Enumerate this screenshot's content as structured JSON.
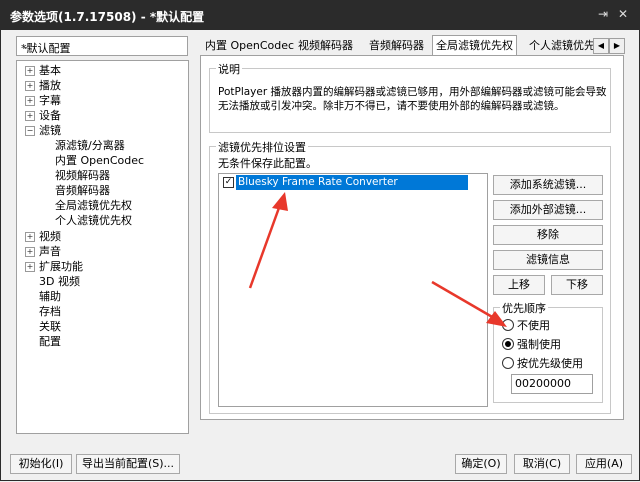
{
  "window": {
    "title": "参数选项(1.7.17508) - *默认配置",
    "pin_glyph": "⇥",
    "close_glyph": "✕"
  },
  "preset": {
    "value": "*默认配置"
  },
  "tree": [
    {
      "label": "基本",
      "expander": "+"
    },
    {
      "label": "播放",
      "expander": "+"
    },
    {
      "label": "字幕",
      "expander": "+"
    },
    {
      "label": "设备",
      "expander": "+"
    },
    {
      "label": "滤镜",
      "expander": "−"
    },
    {
      "label": "源滤镜/分离器"
    },
    {
      "label": "内置 OpenCodec"
    },
    {
      "label": "视频解码器"
    },
    {
      "label": "音频解码器"
    },
    {
      "label": "全局滤镜优先权"
    },
    {
      "label": "个人滤镜优先权"
    },
    {
      "label": "视频",
      "expander": "+"
    },
    {
      "label": "声音",
      "expander": "+"
    },
    {
      "label": "扩展功能",
      "expander": "+"
    },
    {
      "label": "3D 视频"
    },
    {
      "label": "辅助"
    },
    {
      "label": "存档"
    },
    {
      "label": "关联"
    },
    {
      "label": "配置"
    }
  ],
  "tabs": [
    "内置 OpenCodec",
    "视频解码器",
    "音频解码器",
    "全局滤镜优先权",
    "个人滤镜优先"
  ],
  "tab_arrows": {
    "left": "◀",
    "right": "▶"
  },
  "description": {
    "label": "说明",
    "text": "PotPlayer 播放器内置的编解码器或滤镜已够用，用外部编解码器或滤镜可能会导致无法播放或引发冲突。除非万不得已，请不要使用外部的编解码器或滤镜。"
  },
  "filter_priority": {
    "label": "滤镜优先排位设置",
    "note": "无条件保存此配置。",
    "items": [
      {
        "name": "Bluesky Frame Rate Converter",
        "checked": true,
        "check_glyph": "✓"
      }
    ],
    "buttons": {
      "add_system": "添加系统滤镜...",
      "add_external": "添加外部滤镜...",
      "remove": "移除",
      "info": "滤镜信息",
      "up": "上移",
      "down": "下移"
    }
  },
  "priority_order": {
    "label": "优先顺序",
    "options": [
      "不使用",
      "强制使用",
      "按优先级使用"
    ],
    "selected": 1,
    "value": "00200000"
  },
  "bottom": {
    "init": "初始化(I)",
    "export": "导出当前配置(S)...",
    "ok": "确定(O)",
    "cancel": "取消(C)",
    "apply": "应用(A)"
  },
  "colors": {
    "titlebar": "#2b2b2b",
    "selection": "#0078d7",
    "annotation_arrow": "#e8382b"
  }
}
